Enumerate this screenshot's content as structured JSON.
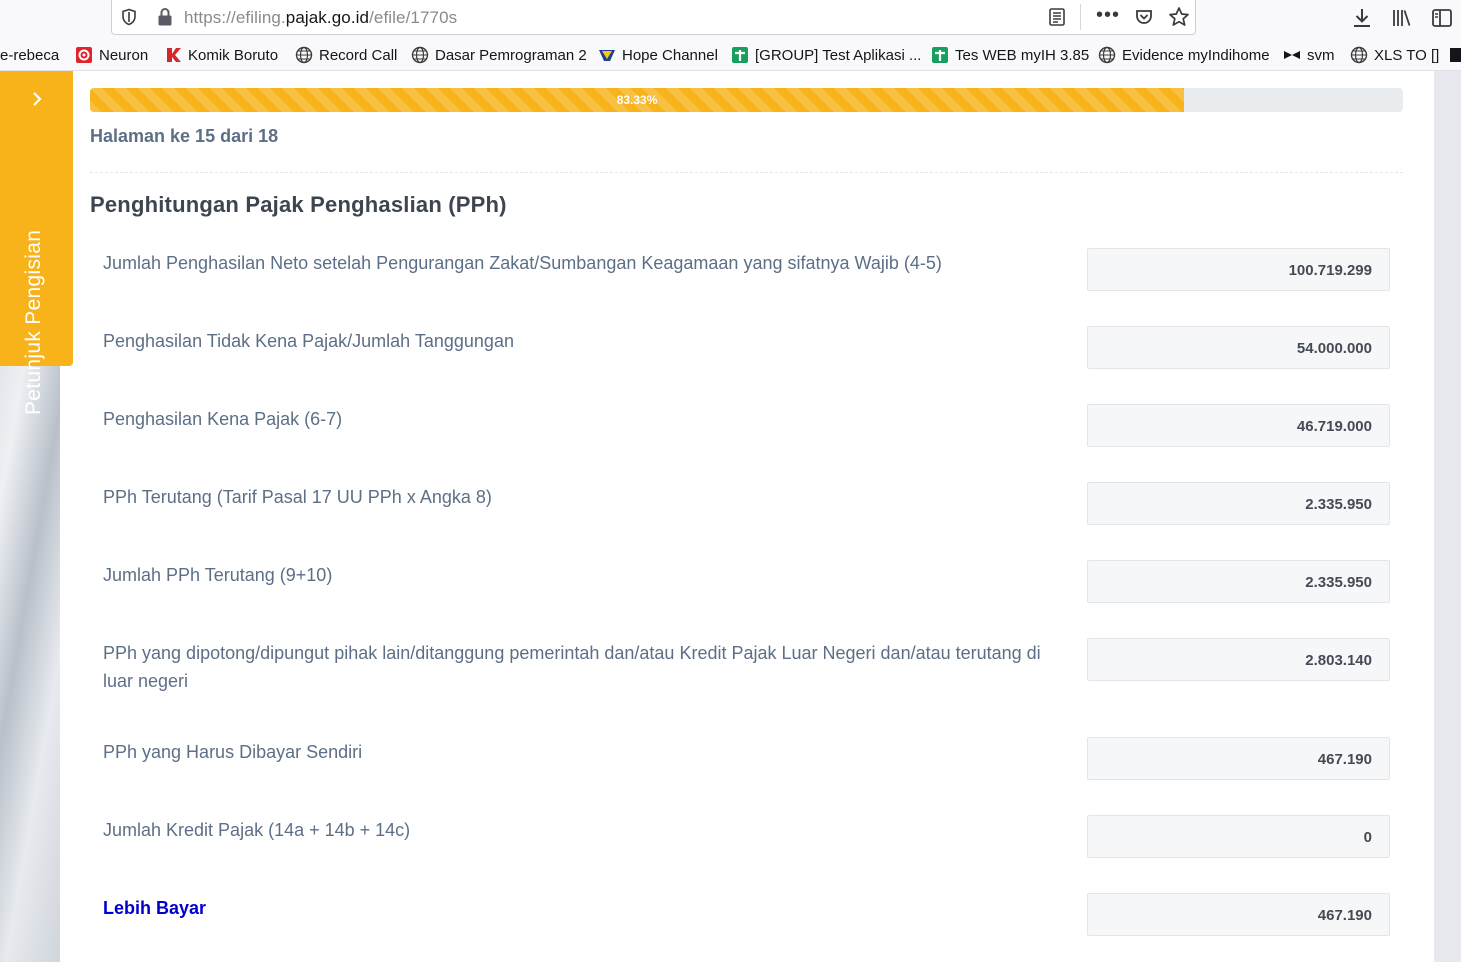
{
  "browser": {
    "url_prefix": "https://efiling.",
    "url_domain": "pajak.go.id",
    "url_path": "/efile/1770s",
    "bookmarks": [
      {
        "label": "e-rebeca",
        "icon": "none"
      },
      {
        "label": "Neuron",
        "icon": "neuron-icon"
      },
      {
        "label": "Komik Boruto",
        "icon": "k-logo-icon"
      },
      {
        "label": "Record Call",
        "icon": "globe-icon"
      },
      {
        "label": "Dasar Pemrograman 2",
        "icon": "globe-icon"
      },
      {
        "label": "Hope Channel",
        "icon": "hope-channel-icon"
      },
      {
        "label": "[GROUP] Test Aplikasi ...",
        "icon": "sheets-icon"
      },
      {
        "label": "Tes WEB myIH 3.85",
        "icon": "sheets-icon"
      },
      {
        "label": "Evidence myIndihome",
        "icon": "globe-icon"
      },
      {
        "label": "svm",
        "icon": "svm-icon"
      },
      {
        "label": "XLS TO []",
        "icon": "globe-icon"
      }
    ]
  },
  "sidebar": {
    "label": "Petunjuk Pengisian"
  },
  "progress": {
    "percent": 83.33,
    "label": "83.33%"
  },
  "page_indicator": "Halaman ke 15 dari 18",
  "section_title": "Penghitungan Pajak Penghaslian (PPh)",
  "rows": [
    {
      "label": "Jumlah Penghasilan Neto setelah Pengurangan Zakat/Sumbangan Keagamaan yang sifatnya Wajib (4-5)",
      "value": "100.719.299"
    },
    {
      "label": "Penghasilan Tidak Kena Pajak/Jumlah Tanggungan",
      "value": "54.000.000"
    },
    {
      "label": "Penghasilan Kena Pajak (6-7)",
      "value": "46.719.000"
    },
    {
      "label": "PPh Terutang (Tarif Pasal 17 UU PPh x Angka 8)",
      "value": "2.335.950"
    },
    {
      "label": "Jumlah PPh Terutang (9+10)",
      "value": "2.335.950"
    },
    {
      "label": "PPh yang dipotong/dipungut pihak lain/ditanggung pemerintah dan/atau Kredit Pajak Luar Negeri dan/atau terutang di luar negeri",
      "value": "2.803.140"
    },
    {
      "label": "PPh yang Harus Dibayar Sendiri",
      "value": "467.190"
    },
    {
      "label": "Jumlah Kredit Pajak (14a + 14b + 14c)",
      "value": "0"
    },
    {
      "label": "Lebih Bayar",
      "value": "467.190"
    }
  ],
  "colors": {
    "accent": "#f8b31a",
    "label_text": "#5d6f86",
    "highlight_label": "#0000cd"
  }
}
